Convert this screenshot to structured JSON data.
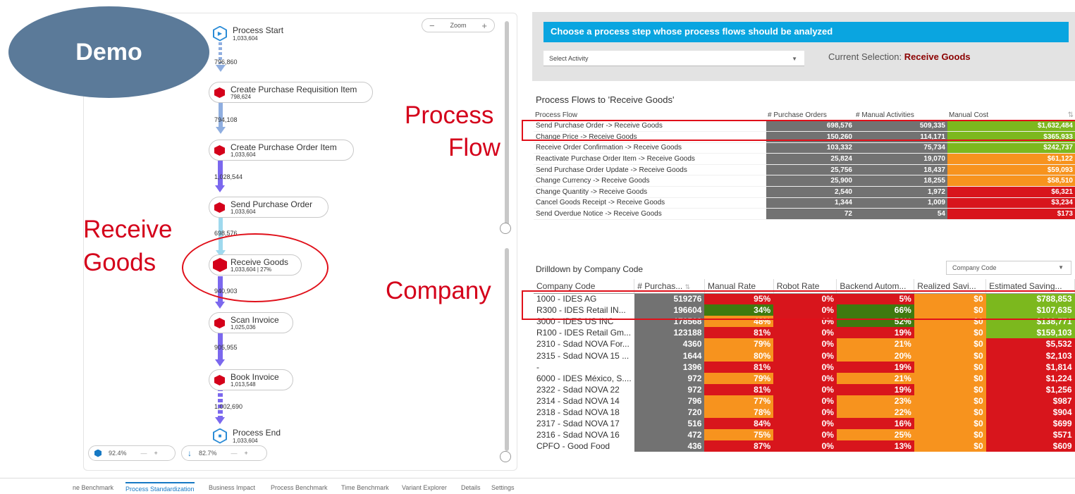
{
  "demo_label": "Demo",
  "callouts": {
    "process_flow_1": "Process",
    "process_flow_2": "Flow",
    "receive_1": "Receive",
    "receive_2": "Goods",
    "company": "Company"
  },
  "process_map": {
    "zoom_label": "Zoom",
    "nodes": [
      {
        "name": "Process Start",
        "count": "1,033,604"
      },
      {
        "name": "Create Purchase Requisition Item",
        "count": "798,624"
      },
      {
        "name": "Create Purchase Order Item",
        "count": "1,033,604"
      },
      {
        "name": "Send Purchase Order",
        "count": "1,033,604"
      },
      {
        "name": "Receive Goods",
        "count": "1,033,604 | 27%"
      },
      {
        "name": "Scan Invoice",
        "count": "1,025,036"
      },
      {
        "name": "Book Invoice",
        "count": "1,013,548"
      },
      {
        "name": "Process End",
        "count": "1,033,604"
      }
    ],
    "edges": [
      "796,860",
      "794,108",
      "1,028,544",
      "698,576",
      "940,903",
      "905,955",
      "1,002,690"
    ],
    "slider_activities": "92.4%",
    "slider_connections": "82.7%"
  },
  "selection": {
    "banner": "Choose a process step whose process flows should be analyzed",
    "dropdown_placeholder": "Select Activity",
    "current_label": "Current Selection:",
    "current_value": "Receive Goods"
  },
  "flows": {
    "title": "Process Flows to 'Receive Goods'",
    "headers": [
      "Process Flow",
      "# Purchase Orders",
      "# Manual Activities",
      "Manual Cost"
    ],
    "rows": [
      {
        "flow": "Send Purchase Order -> Receive Goods",
        "po": "698,576",
        "manual": "509,335",
        "cost": "$1,632,484",
        "color": "#7cb81e"
      },
      {
        "flow": "Change Price -> Receive Goods",
        "po": "150,260",
        "manual": "114,171",
        "cost": "$365,933",
        "color": "#7cb81e"
      },
      {
        "flow": "Receive Order Confirmation -> Receive Goods",
        "po": "103,332",
        "manual": "75,734",
        "cost": "$242,737",
        "color": "#7cb81e"
      },
      {
        "flow": "Reactivate Purchase Order Item -> Receive Goods",
        "po": "25,824",
        "manual": "19,070",
        "cost": "$61,122",
        "color": "#f7931e"
      },
      {
        "flow": "Send Purchase Order Update -> Receive Goods",
        "po": "25,756",
        "manual": "18,437",
        "cost": "$59,093",
        "color": "#f7931e"
      },
      {
        "flow": "Change Currency -> Receive Goods",
        "po": "25,900",
        "manual": "18,255",
        "cost": "$58,510",
        "color": "#f7931e"
      },
      {
        "flow": "Change Quantity -> Receive Goods",
        "po": "2,540",
        "manual": "1,972",
        "cost": "$6,321",
        "color": "#d8151c"
      },
      {
        "flow": "Cancel Goods Receipt -> Receive Goods",
        "po": "1,344",
        "manual": "1,009",
        "cost": "$3,234",
        "color": "#d8151c"
      },
      {
        "flow": "Send Overdue Notice -> Receive Goods",
        "po": "72",
        "manual": "54",
        "cost": "$173",
        "color": "#d8151c"
      }
    ]
  },
  "company": {
    "title": "Drilldown by Company Code",
    "dropdown": "Company Code",
    "headers": [
      "Company Code",
      "# Purchas...",
      "Manual Rate",
      "Robot Rate",
      "Backend Autom...",
      "Realized Savi...",
      "Estimated Saving..."
    ],
    "rows": [
      {
        "code": "1000 - IDES AG",
        "po": "519276",
        "manual": "95%",
        "mc": "#d8151c",
        "robot": "0%",
        "backend": "5%",
        "bc": "#d8151c",
        "realized": "$0",
        "est": "$788,853",
        "ec": "#7cb81e"
      },
      {
        "code": "R300 - IDES Retail IN...",
        "po": "196604",
        "manual": "34%",
        "mc": "#3f7a0f",
        "robot": "0%",
        "backend": "66%",
        "bc": "#3f7a0f",
        "realized": "$0",
        "est": "$107,635",
        "ec": "#7cb81e"
      },
      {
        "code": "3000 - IDES US INC",
        "po": "178568",
        "manual": "48%",
        "mc": "#f7931e",
        "robot": "0%",
        "backend": "52%",
        "bc": "#3f7a0f",
        "realized": "$0",
        "est": "$138,771",
        "ec": "#7cb81e"
      },
      {
        "code": "R100 - IDES Retail Gm...",
        "po": "123188",
        "manual": "81%",
        "mc": "#d8151c",
        "robot": "0%",
        "backend": "19%",
        "bc": "#d8151c",
        "realized": "$0",
        "est": "$159,103",
        "ec": "#7cb81e"
      },
      {
        "code": "2310 - Sdad NOVA For...",
        "po": "4360",
        "manual": "79%",
        "mc": "#f7931e",
        "robot": "0%",
        "backend": "21%",
        "bc": "#f7931e",
        "realized": "$0",
        "est": "$5,532",
        "ec": "#d8151c"
      },
      {
        "code": "2315 - Sdad NOVA 15 ...",
        "po": "1644",
        "manual": "80%",
        "mc": "#f7931e",
        "robot": "0%",
        "backend": "20%",
        "bc": "#f7931e",
        "realized": "$0",
        "est": "$2,103",
        "ec": "#d8151c"
      },
      {
        "code": "-",
        "po": "1396",
        "manual": "81%",
        "mc": "#d8151c",
        "robot": "0%",
        "backend": "19%",
        "bc": "#d8151c",
        "realized": "$0",
        "est": "$1,814",
        "ec": "#d8151c"
      },
      {
        "code": "6000 - IDES México, S....",
        "po": "972",
        "manual": "79%",
        "mc": "#f7931e",
        "robot": "0%",
        "backend": "21%",
        "bc": "#f7931e",
        "realized": "$0",
        "est": "$1,224",
        "ec": "#d8151c"
      },
      {
        "code": "2322 - Sdad NOVA 22",
        "po": "972",
        "manual": "81%",
        "mc": "#d8151c",
        "robot": "0%",
        "backend": "19%",
        "bc": "#d8151c",
        "realized": "$0",
        "est": "$1,256",
        "ec": "#d8151c"
      },
      {
        "code": "2314 - Sdad NOVA 14",
        "po": "796",
        "manual": "77%",
        "mc": "#f7931e",
        "robot": "0%",
        "backend": "23%",
        "bc": "#f7931e",
        "realized": "$0",
        "est": "$987",
        "ec": "#d8151c"
      },
      {
        "code": "2318 - Sdad NOVA 18",
        "po": "720",
        "manual": "78%",
        "mc": "#f7931e",
        "robot": "0%",
        "backend": "22%",
        "bc": "#f7931e",
        "realized": "$0",
        "est": "$904",
        "ec": "#d8151c"
      },
      {
        "code": "2317 - Sdad NOVA 17",
        "po": "516",
        "manual": "84%",
        "mc": "#d8151c",
        "robot": "0%",
        "backend": "16%",
        "bc": "#d8151c",
        "realized": "$0",
        "est": "$699",
        "ec": "#d8151c"
      },
      {
        "code": "2316 - Sdad NOVA 16",
        "po": "472",
        "manual": "75%",
        "mc": "#f7931e",
        "robot": "0%",
        "backend": "25%",
        "bc": "#f7931e",
        "realized": "$0",
        "est": "$571",
        "ec": "#d8151c"
      },
      {
        "code": "CPFO - Good Food",
        "po": "436",
        "manual": "87%",
        "mc": "#d8151c",
        "robot": "0%",
        "backend": "13%",
        "bc": "#d8151c",
        "realized": "$0",
        "est": "$609",
        "ec": "#d8151c"
      }
    ]
  },
  "tabs": [
    "ne Benchmark",
    "Process Standardization",
    "Business Impact",
    "Process Benchmark",
    "Time Benchmark",
    "Variant Explorer",
    "Details",
    "Settings"
  ],
  "colors": {
    "robot": "#d8151c",
    "realized": "#f7931e",
    "po": "#727272"
  }
}
